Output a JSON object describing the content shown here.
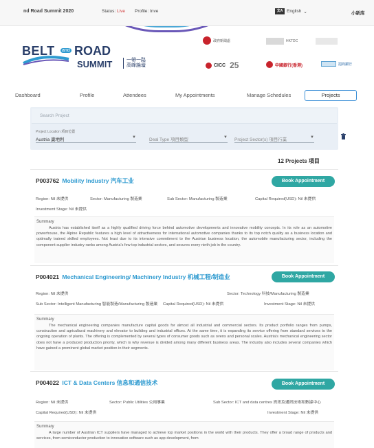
{
  "topbar": {
    "app_title": "nd Road Summit 2020",
    "status_label": "Status:",
    "status_value": "Live",
    "profile_label": "Profile: Inve",
    "lang_icon": "文A",
    "lang_value": "English",
    "user": "小新库"
  },
  "banner": {
    "logo_belt": "BELT",
    "logo_and": "and",
    "logo_road": "ROAD",
    "logo_summit": "SUMMIT",
    "logo_cn_1": "一帶一路",
    "logo_cn_2": "高峰論壇",
    "partner_1": "政府新聞處",
    "partner_2": "HKTDC",
    "partner_3": "CICC",
    "partner_4": "25",
    "partner_5": "中國銀行(香港)",
    "partner_6": "招商銀行"
  },
  "nav": {
    "tabs": [
      "Dashboard",
      "Profile",
      "Attendees",
      "My Appointments",
      "Manage Schedules",
      "Projects"
    ],
    "active": "Projects"
  },
  "search": {
    "placeholder": "Search Project",
    "location_label": "Project Location 項目位置",
    "location_value": "Austria 奧地利",
    "deal_type_placeholder": "Deal Type 項目類型",
    "sector_placeholder": "Project Sector(s) 項目行業"
  },
  "results": {
    "count": "12 Projects 項目"
  },
  "projects": [
    {
      "id": "P003762",
      "name": "Mobility Industry 汽车工业",
      "book": "Book Appointment",
      "region": "Region: Nil 未提供",
      "sector": "Sector: Manufacturing 製造業",
      "sub_sector": "Sub Sector: Manufacturing 製造業",
      "capital": "Capital Required(USD): Nil 未提供",
      "investment_stage": "Investment Stage: Nil 未提供",
      "summary_label": "Summary",
      "summary": "Austria has established itself as a highly qualified driving force behind automotive developments and innovative mobility concepts. In its role as an automotive powerhouse, the Alpine Republic features a high level of attractiveness for international automotive companies thanks to its top notch quality as a business location and optimally trained skilled employees. Not least due to its intensive commitment to the Austrian business location, the automobile manufacturing sector, including the component supplier industry ranks among Austria's few top industrial sectors, and secures every ninth job in the country."
    },
    {
      "id": "P004021",
      "name": "Mechanical Engineering/ Machinery Industry 机械工程/制造业",
      "book": "Book Appointment",
      "region": "Region: Nil 未提供",
      "sector": "Sector: Technology 科技/Manufacturing 製造業",
      "sub_sector": "Sub Sector: Intelligent Manufacturing 智能製造/Manufacturing 製造業",
      "capital": "Capital Required(USD): Nil 未提供",
      "investment_stage": "Investment Stage: Nil 未提供",
      "summary_label": "Summary",
      "summary": "The mechanical engineering companies manufacture capital goods for almost all industrial and commercial sectors. Its product portfolio ranges from pumps, construction and agricultural machinery and elevator to building and industrial offices. At the same time, it is expanding its service offering from standard services to the ongoing operation of plants. The offering is complemented by several types of consumer goods such as ovens and personal scales. Austria's mechanical engineering sector does not have a produced production priority, which is why revenue is divided among many different business areas. The industry also includes several companies which have gained a prominent global market position in their segments."
    },
    {
      "id": "P004022",
      "name": "ICT & Data Centers 信息和通信技术",
      "book": "Book Appointment",
      "region": "Region: Nil 未提供",
      "sector": "Sector: Public Utilities 公用事業",
      "sub_sector": "Sub Sector: ICT and data centres 資訊及通訊技術和數據中心",
      "capital": "Capital Required(USD): Nil 未提供",
      "investment_stage": "Investment Stage: Nil 未提供",
      "summary_label": "Summary",
      "summary": "A large number of Austrian ICT suppliers have managed to achieve top market positions in the world with their products. They offer a broad range of products and services, from semiconductor production to innovative software such as app development, from"
    }
  ],
  "colors": {
    "accent": "#2e9ad0",
    "book_button": "#2fa7a3",
    "panel": "#e9eff6",
    "live": "#d13b3b"
  }
}
